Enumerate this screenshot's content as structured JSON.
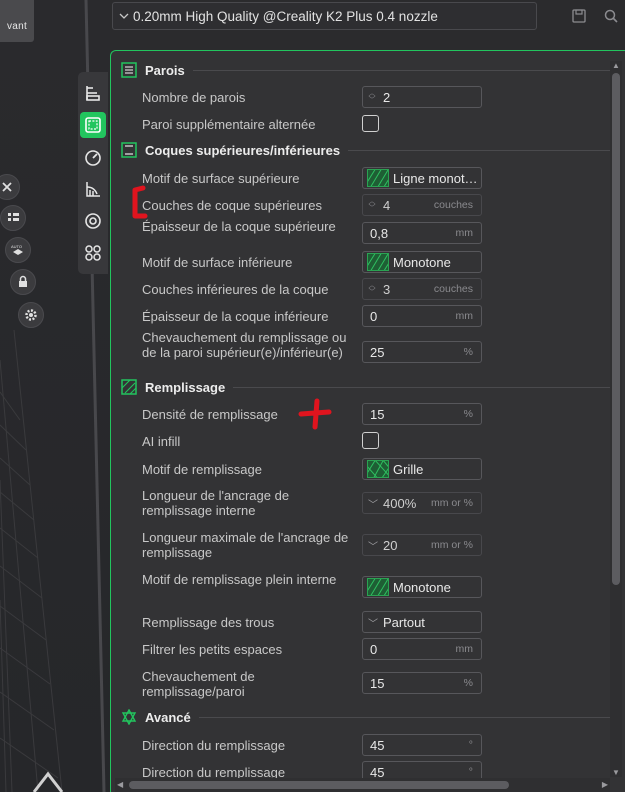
{
  "viewport": {
    "prev_label": "vant",
    "tools": [
      "close-icon",
      "list-icon",
      "auto-arrange-icon",
      "lock-icon",
      "gear-icon"
    ]
  },
  "tabs": [
    "quality-icon",
    "strength-icon",
    "speed-icon",
    "support-icon",
    "multimaterial-icon",
    "others-icon"
  ],
  "preset": {
    "name": "0.20mm High Quality @Creality K2 Plus 0.4 nozzle",
    "icons": [
      "save-icon",
      "search-icon"
    ]
  },
  "sections": {
    "parois": {
      "title": "Parois",
      "wall_count_label": "Nombre de parois",
      "wall_count_value": "2",
      "alt_wall_label": "Paroi supplémentaire alternée"
    },
    "coques": {
      "title": "Coques supérieures/inférieures",
      "top_pattern_label": "Motif de surface supérieure",
      "top_pattern_value": "Ligne monot…",
      "top_layers_label": "Couches de coque supérieures",
      "top_layers_value": "4",
      "top_layers_unit": "couches",
      "top_thickness_label": "Épaisseur de la coque supérieure",
      "top_thickness_value": "0,8",
      "top_thickness_unit": "mm",
      "bottom_pattern_label": "Motif de surface inférieure",
      "bottom_pattern_value": "Monotone",
      "bottom_layers_label": "Couches inférieures de la coque",
      "bottom_layers_value": "3",
      "bottom_layers_unit": "couches",
      "bottom_thickness_label": "Épaisseur de la coque inférieure",
      "bottom_thickness_value": "0",
      "bottom_thickness_unit": "mm",
      "overlap_label": "Chevauchement du remplissage ou de la paroi supérieur(e)/inférieur(e)",
      "overlap_value": "25",
      "overlap_unit": "%"
    },
    "remplissage": {
      "title": "Remplissage",
      "density_label": "Densité de remplissage",
      "density_value": "15",
      "density_unit": "%",
      "ai_label": "AI infill",
      "pattern_label": "Motif de remplissage",
      "pattern_value": "Grille",
      "anchor_label": "Longueur de l'ancrage de remplissage interne",
      "anchor_value": "400%",
      "anchor_unit": "mm or %",
      "anchor_max_label": "Longueur maximale de l'ancrage de remplissage",
      "anchor_max_value": "20",
      "anchor_max_unit": "mm or %",
      "solid_pattern_label": "Motif de remplissage plein interne",
      "solid_pattern_value": "Monotone",
      "gap_fill_label": "Remplissage des trous",
      "gap_fill_value": "Partout",
      "filter_label": "Filtrer les petits espaces",
      "filter_value": "0",
      "filter_unit": "mm",
      "wall_overlap_label": "Chevauchement de remplissage/paroi",
      "wall_overlap_value": "15",
      "wall_overlap_unit": "%"
    },
    "avance": {
      "title": "Avancé",
      "direction_label": "Direction du remplissage",
      "direction_value": "45",
      "direction_unit": "°",
      "direction2_label": "Direction du remplissage",
      "direction2_value": "45",
      "direction2_unit": "°"
    }
  },
  "colors": {
    "accent": "#22c55e",
    "annotation": "#e0141e",
    "panel": "#333335"
  }
}
